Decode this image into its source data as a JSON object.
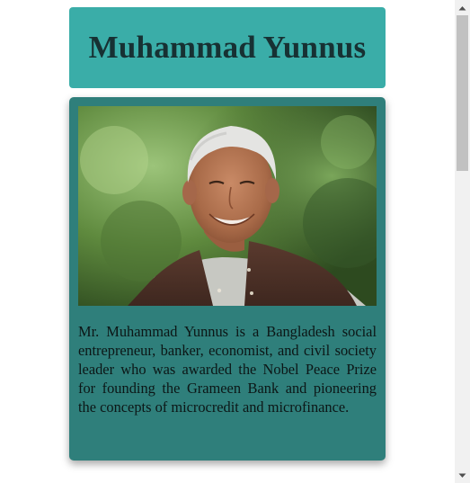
{
  "header": {
    "title": "Muhammad Yunnus"
  },
  "bio": {
    "photo_alt": "Portrait of Muhammad Yunnus",
    "text": "Mr. Muhammad Yunnus is a Bangladesh social entrepreneur, banker, economist, and civil society leader who was awarded the Nobel Peace Prize for founding the Grameen Bank and pioneering the concepts of microcredit and microfinance."
  },
  "scrollbar": {
    "up_icon": "chevron-up-icon",
    "down_icon": "chevron-down-icon"
  },
  "colors": {
    "header_bg": "#3aada8",
    "card_bg": "#2f7f7b",
    "title_text": "#173133"
  }
}
